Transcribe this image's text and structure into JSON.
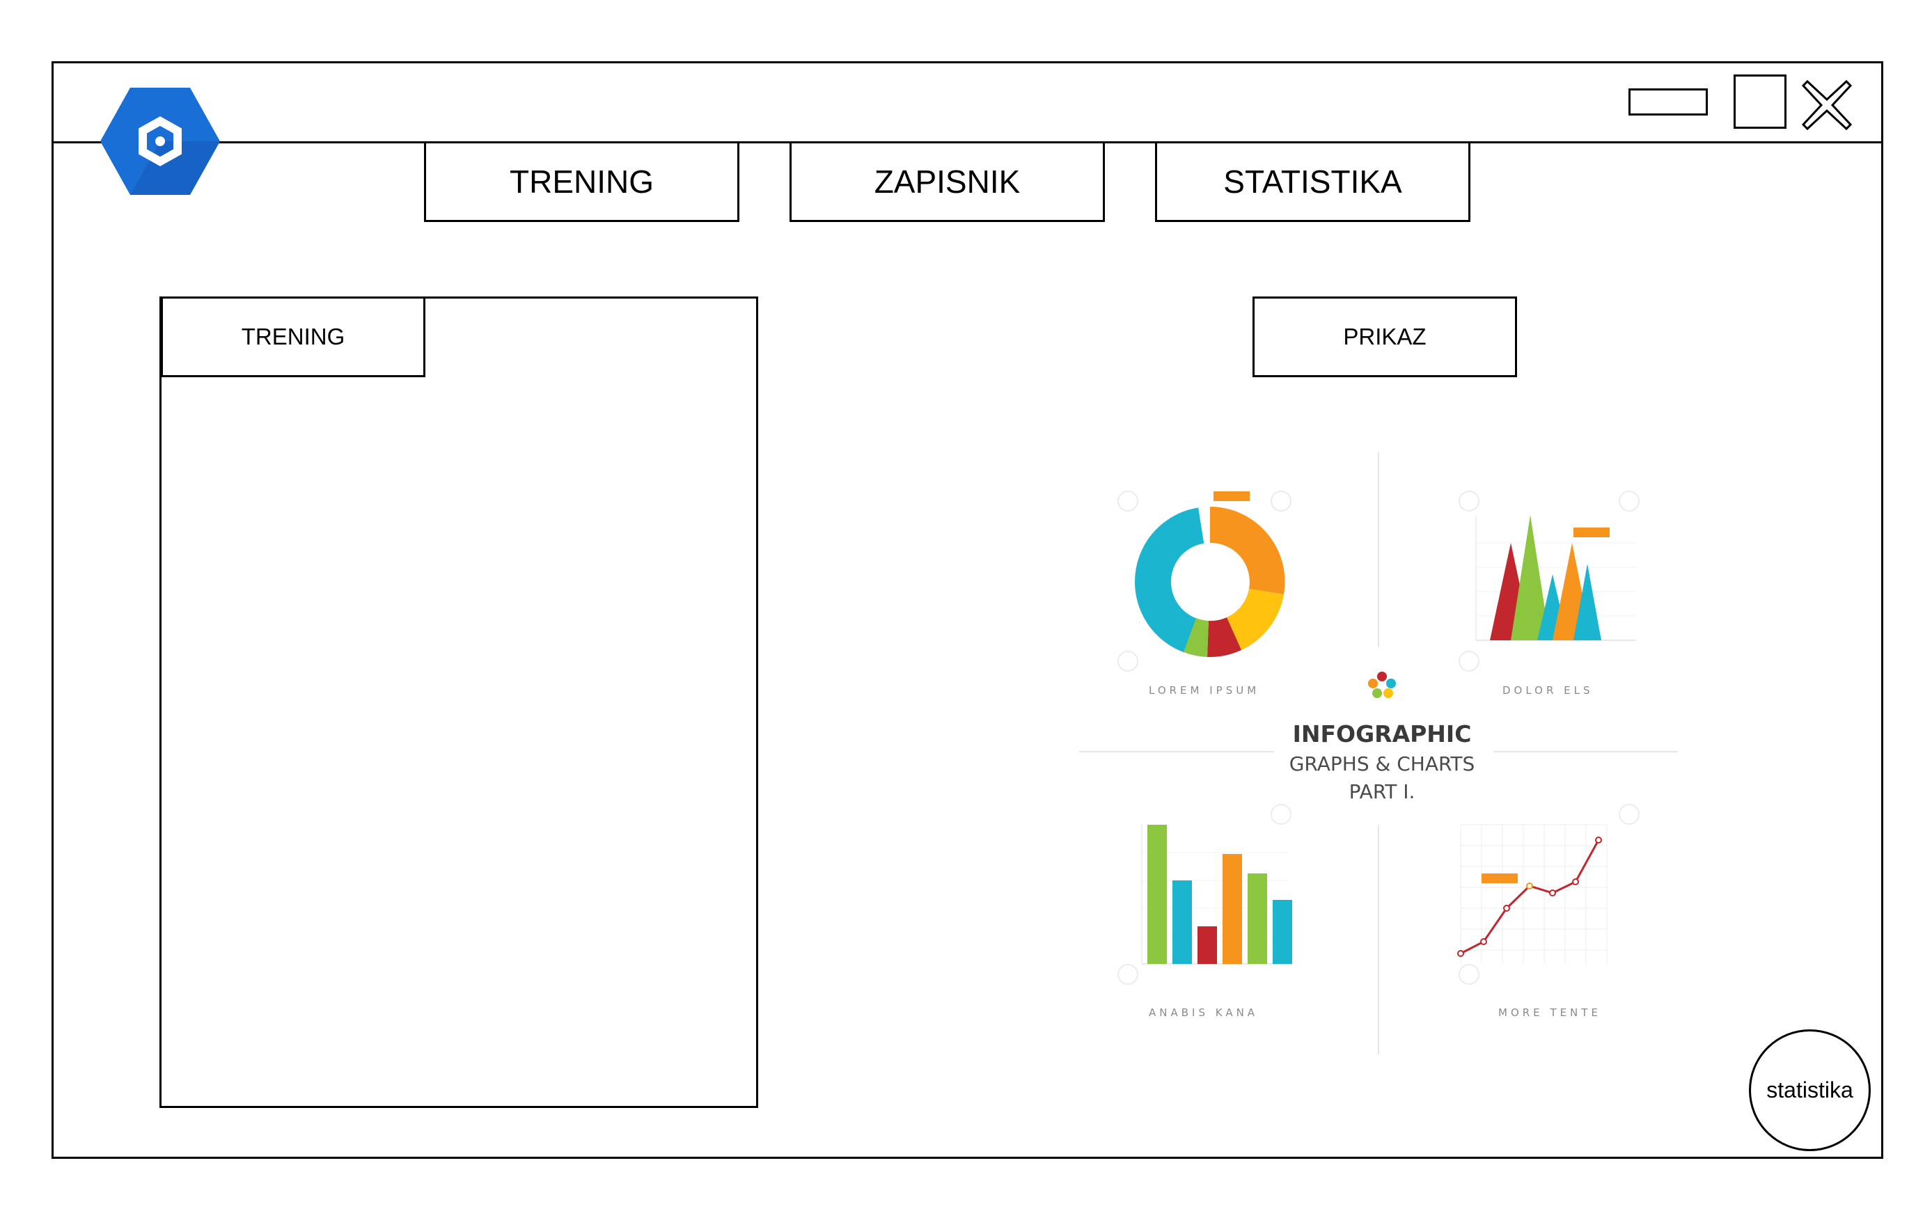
{
  "window": {
    "logo_icon": "hexagon-app-logo-icon",
    "controls": {
      "minimize_icon": "minimize-icon",
      "maximize_icon": "maximize-icon",
      "close_icon": "close-icon"
    }
  },
  "nav": {
    "tabs": [
      {
        "label": "TRENING"
      },
      {
        "label": "ZAPISNIK"
      },
      {
        "label": "STATISTIKA"
      }
    ]
  },
  "panel": {
    "tab_label": "TRENING"
  },
  "actions": {
    "prikaz_label": "PRIKAZ",
    "round_button_label": "statistika"
  },
  "infographic": {
    "title": "INFOGRAPHIC",
    "subtitle": "GRAPHS & CHARTS",
    "part": "PART I.",
    "captions": [
      "LOREM IPSUM",
      "DOLOR ELS",
      "ANABIS KANA",
      "MORE TENTE"
    ],
    "colors": {
      "orange": "#f7941d",
      "teal": "#1cb5d0",
      "green": "#8cc63f",
      "red": "#c1272d",
      "yellow": "#ffc20e"
    }
  }
}
